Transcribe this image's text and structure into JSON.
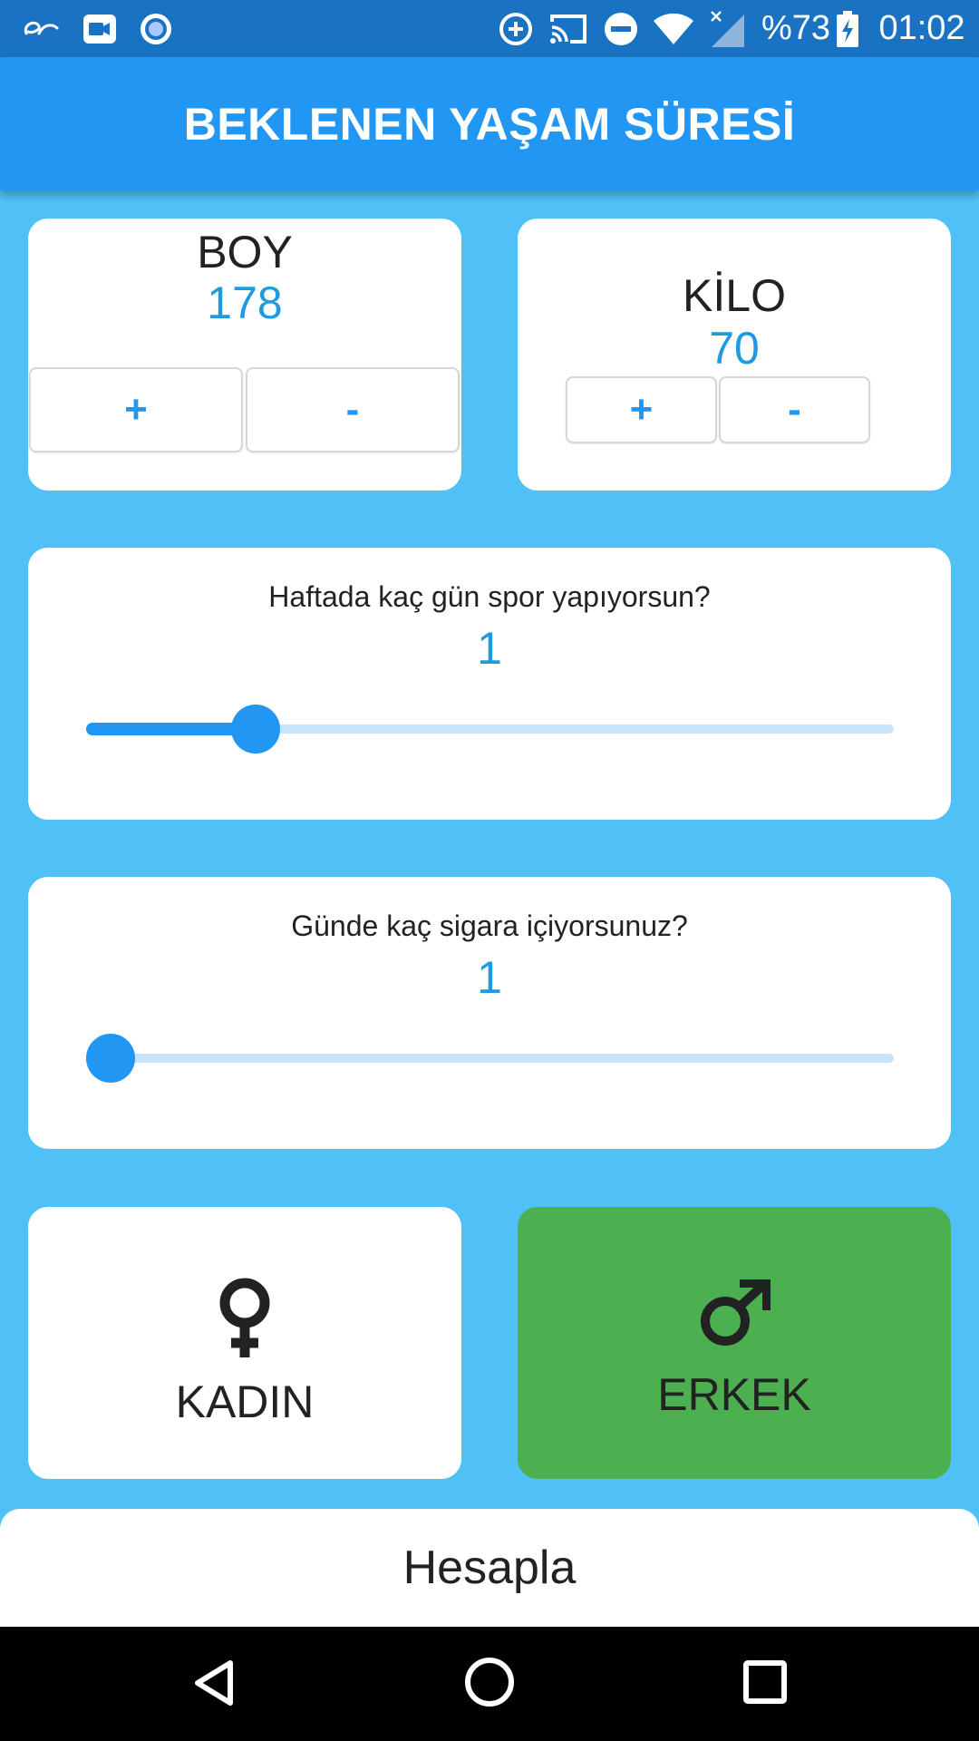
{
  "status_bar": {
    "battery": "%73",
    "time": "01:02",
    "icons": [
      "browser-e-icon",
      "video-camera-icon",
      "record-icon",
      "data-saver-icon",
      "cast-icon",
      "do-not-disturb-icon",
      "wifi-icon",
      "signal-icon",
      "battery-charging-icon"
    ]
  },
  "app_bar": {
    "title": "BEKLENEN YAŞAM SÜRESİ"
  },
  "height_card": {
    "label": "BOY",
    "value": "178",
    "plus_label": "+",
    "minus_label": "-"
  },
  "weight_card": {
    "label": "KİLO",
    "value": "70",
    "plus_label": "+",
    "minus_label": "-"
  },
  "sport_card": {
    "question": "Haftada kaç gün spor yapıyorsun?",
    "value": "1",
    "slider_fraction": 0.21
  },
  "smoke_card": {
    "question": "Günde kaç sigara içiyorsunuz?",
    "value": "1",
    "slider_fraction": 0.03
  },
  "gender": {
    "female": {
      "label": "KADIN",
      "icon": "female-symbol-icon",
      "selected": false
    },
    "male": {
      "label": "ERKEK",
      "icon": "male-symbol-icon",
      "selected": true
    },
    "selected_color": "#4caf50"
  },
  "calculate_button": {
    "label": "Hesapla"
  },
  "colors": {
    "background": "#50c1f7",
    "app_bar": "#2196f3",
    "status_bar": "#1a73c2",
    "accent": "#2196f3",
    "value_text": "#1e9ae0"
  },
  "nav_bar": {
    "icons": [
      "back-triangle-icon",
      "home-circle-icon",
      "recents-square-icon"
    ]
  }
}
